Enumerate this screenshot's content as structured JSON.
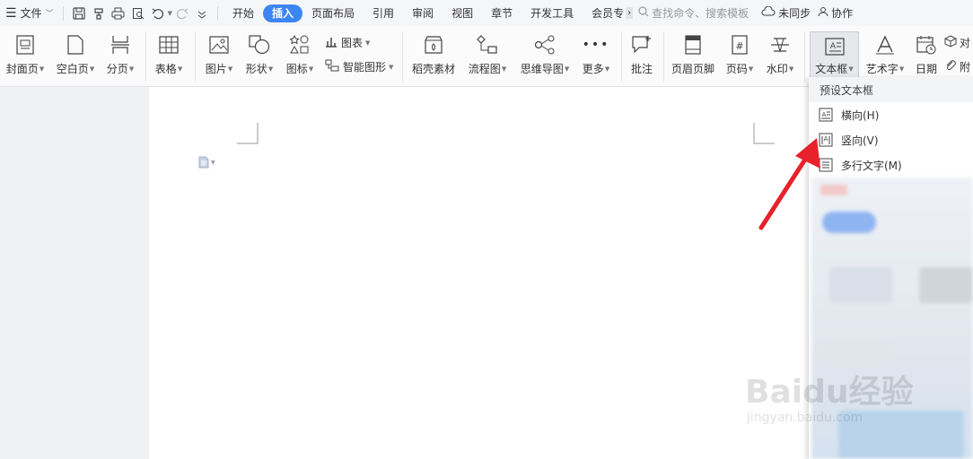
{
  "menubar": {
    "file_label": "文件",
    "tabs": [
      "开始",
      "插入",
      "页面布局",
      "引用",
      "审阅",
      "视图",
      "章节",
      "开发工具",
      "会员专"
    ],
    "active_tab": "插入",
    "search_placeholder": "查找命令、搜索模板",
    "sync_label": "未同步",
    "collab_label": "协作"
  },
  "ribbon": {
    "cover": "封面页",
    "blank": "空白页",
    "pagebreak": "分页",
    "table": "表格",
    "picture": "图片",
    "shape": "形状",
    "icon": "图标",
    "chart": "图表",
    "smartart": "智能图形",
    "material": "稻壳素材",
    "flowchart": "流程图",
    "mindmap": "思维导图",
    "more": "更多",
    "comment": "批注",
    "headerfooter": "页眉页脚",
    "pagenum": "页码",
    "watermark": "水印",
    "textbox": "文本框",
    "wordart": "艺术字",
    "date": "日期",
    "object_partial": "对",
    "attach_partial": "附"
  },
  "dropdown": {
    "title": "预设文本框",
    "items": [
      "横向(H)",
      "竖向(V)",
      "多行文字(M)"
    ]
  },
  "watermark": {
    "brand": "Baidu经验",
    "url": "jingyan.baidu.com"
  },
  "colors": {
    "accent": "#3c86f1",
    "arrow": "#e8212a"
  }
}
